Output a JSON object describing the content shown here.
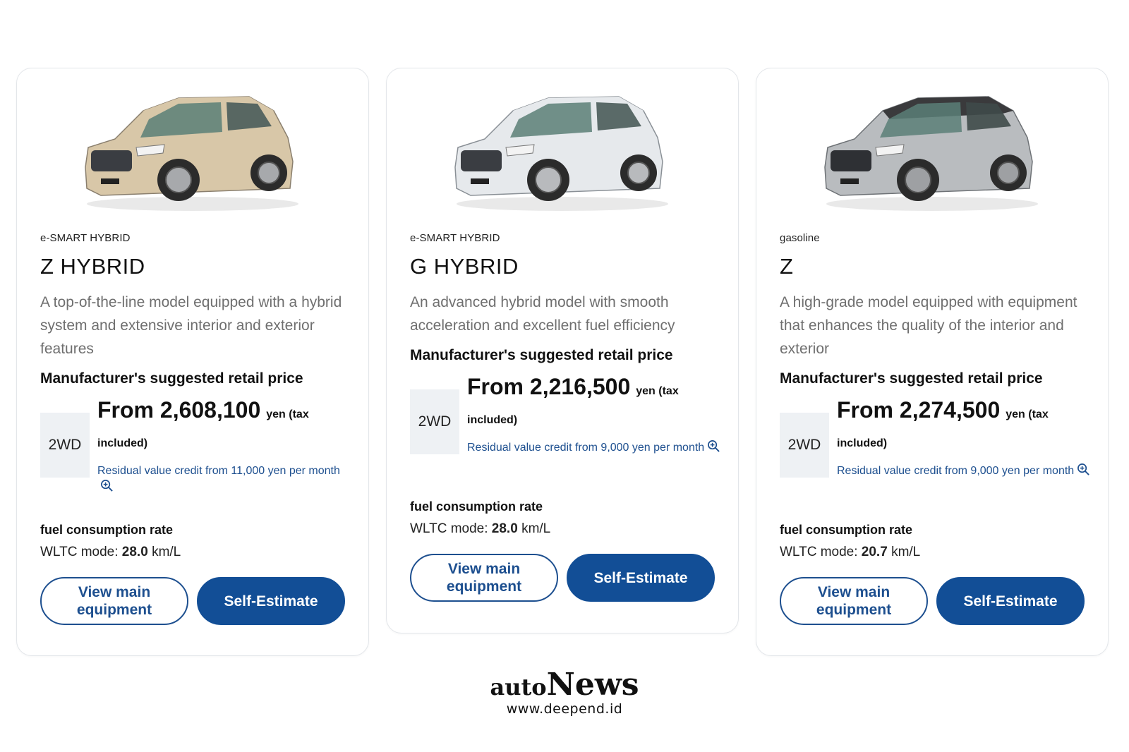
{
  "cards": [
    {
      "engine": "e-SMART HYBRID",
      "model": "Z HYBRID",
      "description": "A top-of-the-line model equipped with a hybrid system and extensive interior and exterior features",
      "price_heading": "Manufacturer's suggested retail price",
      "drive": "2WD",
      "price": "From 2,608,100",
      "price_unit": "yen (tax",
      "price_included": "included)",
      "residual": "Residual value credit from 11,000 yen per month",
      "fuel_heading": "fuel consumption rate",
      "fuel_mode_label": "WLTC mode:",
      "fuel_value": "28.0",
      "fuel_unit": "km/L",
      "btn_equipment": "View main equipment",
      "btn_estimate": "Self-Estimate",
      "car_color": "#d8c7a8",
      "roof_color": "#d8c7a8"
    },
    {
      "engine": "e-SMART HYBRID",
      "model": "G HYBRID",
      "description": "An advanced hybrid model with smooth acceleration and excellent fuel efficiency",
      "price_heading": "Manufacturer's suggested retail price",
      "drive": "2WD",
      "price": "From 2,216,500",
      "price_unit": "yen (tax",
      "price_included": "included)",
      "residual": "Residual value credit from 9,000 yen per month",
      "fuel_heading": "fuel consumption rate",
      "fuel_mode_label": "WLTC mode:",
      "fuel_value": "28.0",
      "fuel_unit": "km/L",
      "btn_equipment": "View main equipment",
      "btn_estimate": "Self-Estimate",
      "car_color": "#e6e9ec",
      "roof_color": "#e6e9ec"
    },
    {
      "engine": "gasoline",
      "model": "Z",
      "description": "A high-grade model equipped with equipment that enhances the quality of the interior and exterior",
      "price_heading": "Manufacturer's suggested retail price",
      "drive": "2WD",
      "price": "From 2,274,500",
      "price_unit": "yen (tax",
      "price_included": "included)",
      "residual": "Residual value credit from 9,000 yen per month",
      "fuel_heading": "fuel consumption rate",
      "fuel_mode_label": "WLTC mode:",
      "fuel_value": "20.7",
      "fuel_unit": "km/L",
      "btn_equipment": "View main equipment",
      "btn_estimate": "Self-Estimate",
      "car_color": "#b9bcbf",
      "roof_color": "#3a3a3c"
    }
  ],
  "watermark": {
    "name_a": "auto",
    "name_b": "News",
    "url": "www.deepend.id"
  },
  "colors": {
    "accent": "#124e96",
    "link": "#1d4f8f",
    "drive_box": "#eef1f4"
  }
}
